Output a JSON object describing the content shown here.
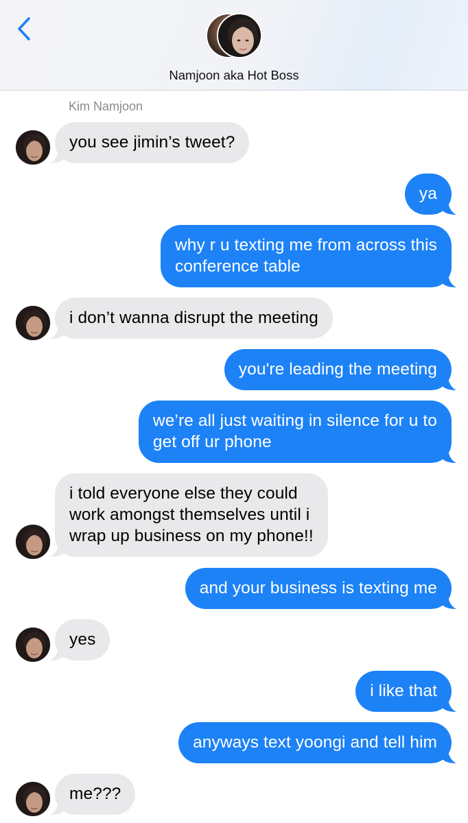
{
  "header": {
    "back_icon": "chevron-left-icon",
    "contact_name": "Namjoon aka Hot Boss",
    "colors": {
      "accent": "#1d82f6"
    }
  },
  "thread": {
    "sender_name": "Kim Namjoon",
    "colors": {
      "incoming": "#e9e9eb",
      "outgoing": "#1d82f6"
    },
    "messages": [
      {
        "from": "them",
        "lines": [
          "you see jimin’s tweet?"
        ]
      },
      {
        "from": "me",
        "lines": [
          "ya"
        ]
      },
      {
        "from": "me",
        "lines": [
          "why r u texting me from across this",
          "conference table"
        ]
      },
      {
        "from": "them",
        "lines": [
          "i don’t wanna disrupt the meeting"
        ]
      },
      {
        "from": "me",
        "lines": [
          "you're leading the meeting"
        ]
      },
      {
        "from": "me",
        "lines": [
          "we’re all just waiting in silence for u to",
          "get off ur phone"
        ]
      },
      {
        "from": "them",
        "lines": [
          "i told everyone else they could",
          "work amongst themselves until i",
          "wrap up business on my phone!!"
        ]
      },
      {
        "from": "me",
        "lines": [
          "and your business is texting me"
        ]
      },
      {
        "from": "them",
        "lines": [
          "yes"
        ]
      },
      {
        "from": "me",
        "lines": [
          "i like that"
        ]
      },
      {
        "from": "me",
        "lines": [
          "anyways text yoongi and tell him"
        ]
      },
      {
        "from": "them",
        "lines": [
          "me???"
        ]
      }
    ]
  }
}
